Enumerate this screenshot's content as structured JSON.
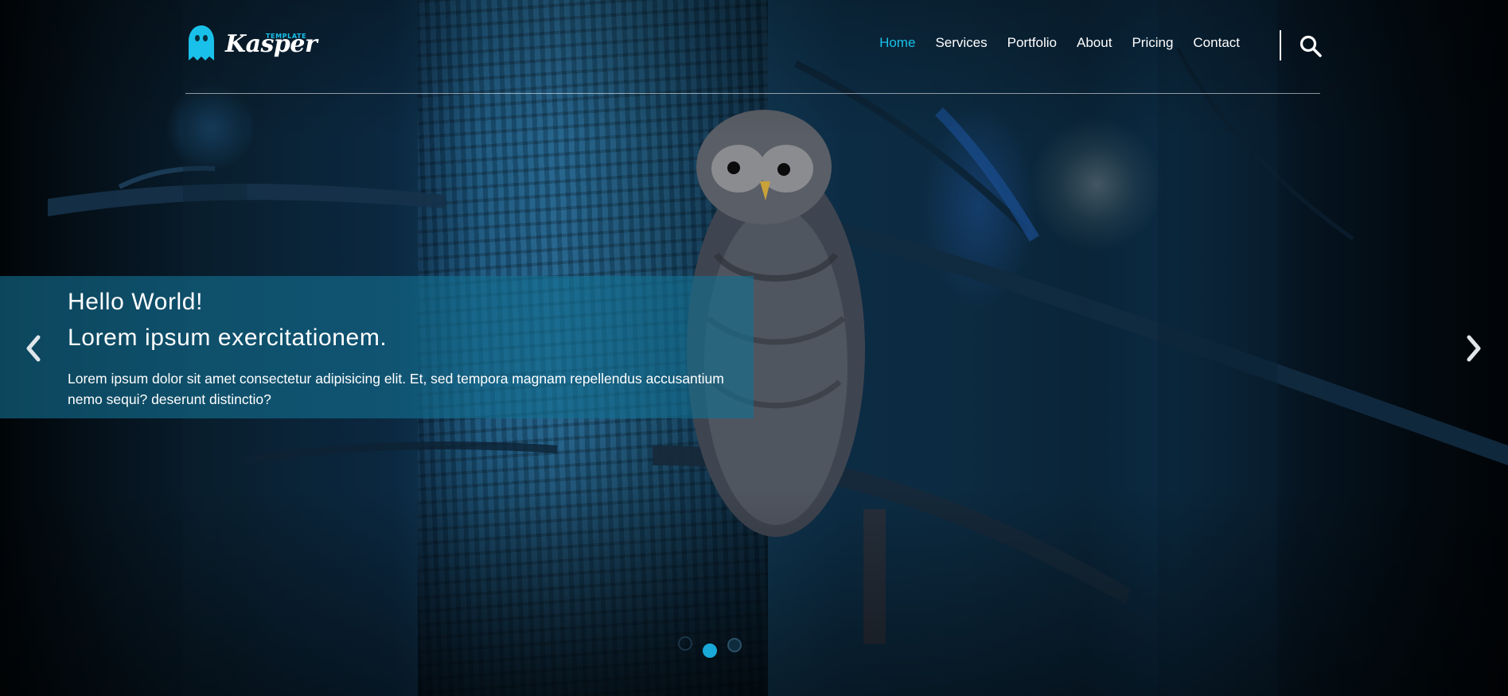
{
  "brand": {
    "name": "Kasper",
    "tagline": "TEMPLATE",
    "accent_color": "#19c1ea"
  },
  "nav": {
    "items": [
      {
        "label": "Home",
        "active": true
      },
      {
        "label": "Services",
        "active": false
      },
      {
        "label": "Portfolio",
        "active": false
      },
      {
        "label": "About",
        "active": false
      },
      {
        "label": "Pricing",
        "active": false
      },
      {
        "label": "Contact",
        "active": false
      }
    ],
    "search_icon": "search-icon"
  },
  "slider": {
    "caption": {
      "title_line1": "Hello World!",
      "title_line2": "Lorem ipsum exercitationem.",
      "body": "Lorem ipsum dolor sit amet consectetur adipisicing elit. Et, sed tempora magnam repellendus accusantium nemo sequi? deserunt distinctio?",
      "background": "#136f92"
    },
    "prev_icon": "chevron-left-icon",
    "next_icon": "chevron-right-icon",
    "dots": {
      "count": 3,
      "active_index": 1
    },
    "background_image": "owl perched on tree branch at night"
  }
}
